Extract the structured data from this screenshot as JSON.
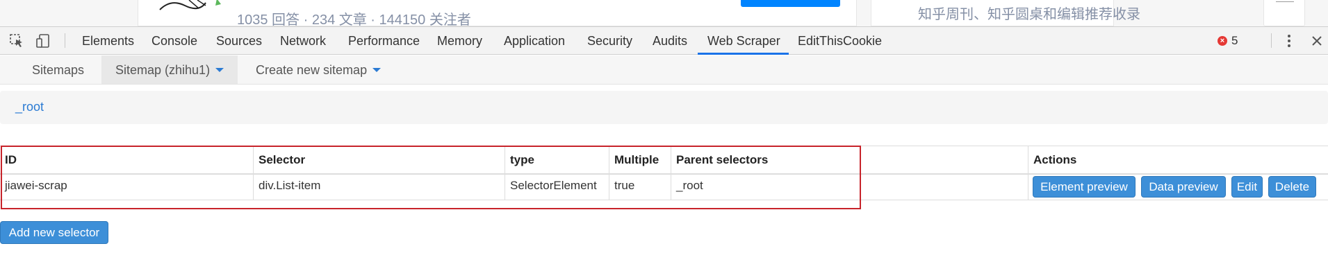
{
  "page": {
    "stats": "1035 回答 · 234 文章 · 144150 关注者",
    "right_text": "知乎周刊、知乎圆桌和编辑推荐收录"
  },
  "devtools": {
    "tabs": [
      "Elements",
      "Console",
      "Sources",
      "Network",
      "Performance",
      "Memory",
      "Application",
      "Security",
      "Audits",
      "Web Scraper",
      "EditThisCookie"
    ],
    "active_tab": "Web Scraper",
    "error_count": "5",
    "icons": [
      "inspect-icon",
      "device-toolbar-icon",
      "error-icon",
      "more-vert-icon",
      "close-icon"
    ]
  },
  "subnav": {
    "sitemaps": "Sitemaps",
    "current": "Sitemap (zhihu1)",
    "create": "Create new sitemap"
  },
  "breadcrumb": "_root",
  "table": {
    "headers": [
      "ID",
      "Selector",
      "type",
      "Multiple",
      "Parent selectors",
      "Actions"
    ],
    "rows": [
      [
        "jiawei-scrap",
        "div.List-item",
        "SelectorElement",
        "true",
        "_root"
      ]
    ],
    "actions": [
      "Element preview",
      "Data preview",
      "Edit",
      "Delete"
    ]
  },
  "add_button": "Add new selector",
  "colors": {
    "accent": "#3d8fd8",
    "link": "#2b7bd3",
    "highlight_border": "#c7232a",
    "active_tab_underline": "#1a73e8",
    "error": "#e53935"
  }
}
